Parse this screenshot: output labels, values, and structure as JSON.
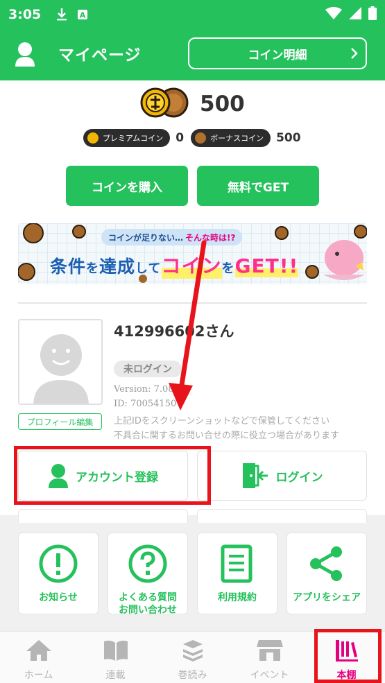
{
  "status_bar": {
    "time": "3:05"
  },
  "header": {
    "title": "マイページ",
    "coin_detail_label": "コイン明細"
  },
  "coins": {
    "total": "500",
    "premium_label": "プレミアムコイン",
    "premium_count": "0",
    "bonus_label": "ボーナスコイン",
    "bonus_count": "500"
  },
  "actions": {
    "buy_label": "コインを購入",
    "free_label": "無料でGET"
  },
  "banner": {
    "pill_text": "コインが足りない…",
    "pill_emph": "そんな時は!?",
    "w1": "条件",
    "p1": "を",
    "w2": "達成",
    "p2": "して",
    "w3": "コイン",
    "p3": "を",
    "w4": "GET!!"
  },
  "profile": {
    "username": "412996602さん",
    "login_status": "未ログイン",
    "version": "Version: 7.08.00",
    "id": "ID: 70054150",
    "note_line1": "上記IDをスクリーンショットなどで保管してください",
    "note_line2": "不具合に関するお問い合せの際に役立つ場合があります",
    "edit_label": "プロフィール編集"
  },
  "account": {
    "register_label": "アカウント登録",
    "login_label": "ログイン"
  },
  "tiles": [
    {
      "label": "お知らせ",
      "icon": "exclamation-icon"
    },
    {
      "label": "よくある質問\nお問い合わせ",
      "icon": "question-icon"
    },
    {
      "label": "利用規約",
      "icon": "document-icon"
    },
    {
      "label": "アプリをシェア",
      "icon": "share-icon"
    }
  ],
  "tile_labels": {
    "t0": "お知らせ",
    "t1a": "よくある質問",
    "t1b": "お問い合わせ",
    "t2": "利用規約",
    "t3": "アプリをシェア"
  },
  "bottom_nav": [
    {
      "label": "ホーム",
      "icon": "home-icon"
    },
    {
      "label": "連載",
      "icon": "book-icon"
    },
    {
      "label": "巻読み",
      "icon": "stack-icon"
    },
    {
      "label": "イベント",
      "icon": "shop-icon"
    },
    {
      "label": "本棚",
      "icon": "bookshelf-icon",
      "active": true
    }
  ],
  "colors": {
    "brand_green": "#25c15c",
    "active_pink": "#e4007f",
    "annotation_red": "#e8141b"
  }
}
